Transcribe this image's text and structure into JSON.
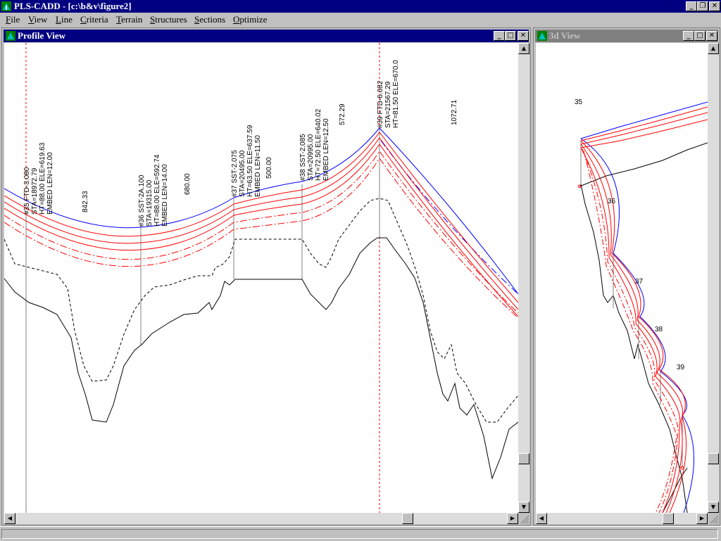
{
  "app": {
    "title": "PLS-CADD - [c:\\b&v\\figure2]"
  },
  "menu": [
    "File",
    "View",
    "Line",
    "Criteria",
    "Terrain",
    "Structures",
    "Sections",
    "Optimize"
  ],
  "profile": {
    "title": "Profile View",
    "structures": [
      {
        "line1": "#35 FTD-3.080",
        "line2": "STA=18972.79",
        "line3": "HT=88.00 ELE=619.63",
        "line4": "EMBED LEN=12.00"
      },
      {
        "line1": "#36 SST-2A.100",
        "line2": "STA=19315.00",
        "line3": "HT=88.00 ELE=592.74",
        "line4": "EMBED LEN=14.00"
      },
      {
        "line1": "#37 SST-2.075",
        "line2": "STA=20495.00",
        "line3": "HT=63.50 ELE=637.59",
        "line4": "EMBED LEN=11.50"
      },
      {
        "line1": "#38 SST-2.085",
        "line2": "STA=20995.00",
        "line3": "HT=72.50 ELE=640.02",
        "line4": "EMBED LEN=12.50"
      },
      {
        "line1": "#39 FTD-6.082",
        "line2": "STA=21567.29",
        "line3": "HT=81.50 ELE=670.0"
      }
    ],
    "spans": [
      "842.33",
      "680.00",
      "500.00",
      "572.29",
      "1072.71"
    ]
  },
  "view3d": {
    "title": "3d View",
    "labels": [
      "35",
      "36",
      "37",
      "38",
      "39"
    ]
  },
  "icons": {
    "window_controls": [
      "minimize-icon",
      "maximize-icon",
      "close-icon"
    ],
    "scroll": [
      "arrow-up-icon",
      "arrow-down-icon",
      "arrow-left-icon",
      "arrow-right-icon"
    ]
  }
}
